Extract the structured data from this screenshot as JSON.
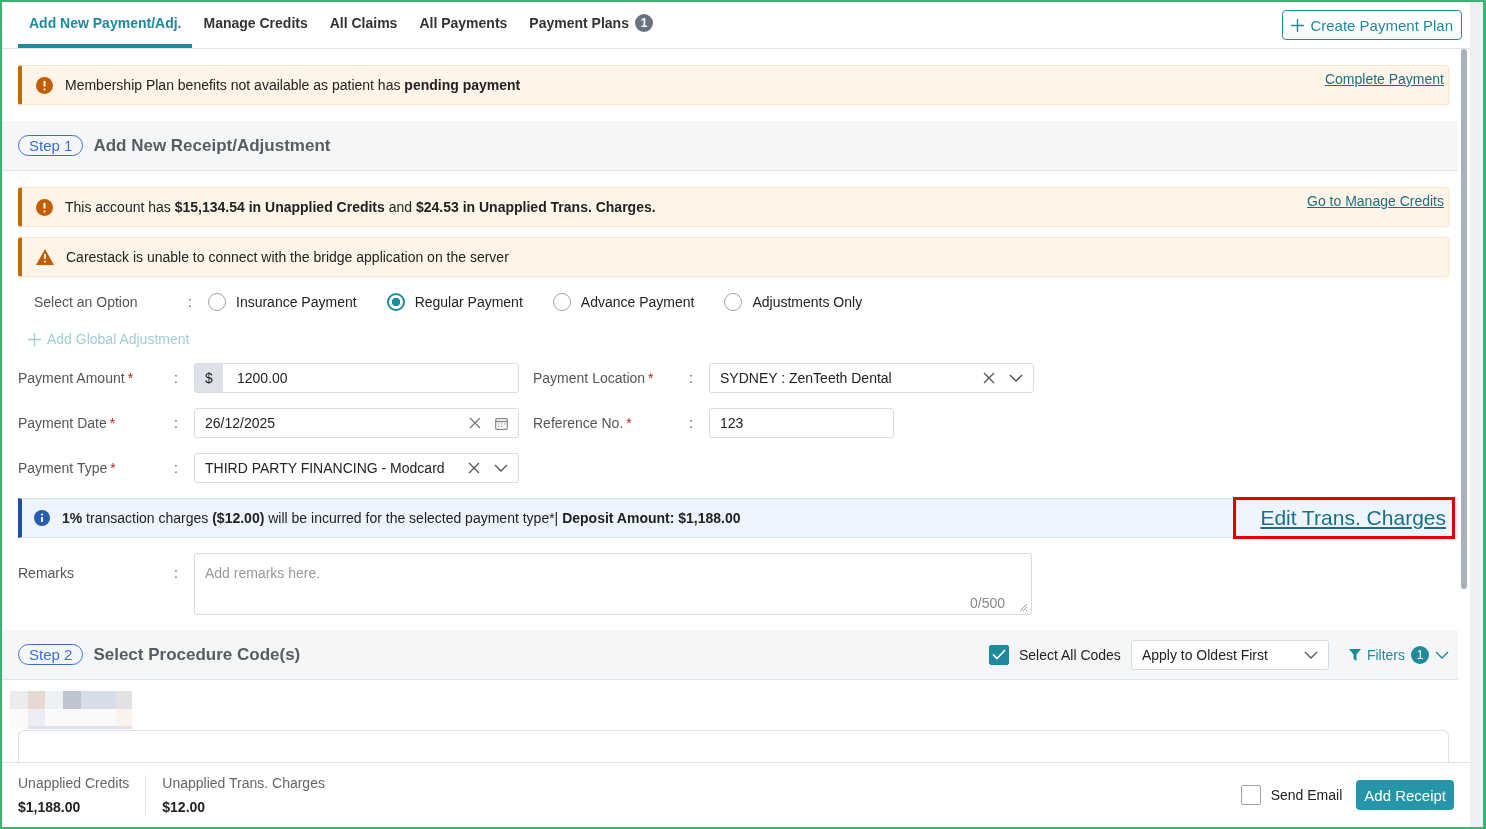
{
  "tabs": [
    {
      "label": "Add New Payment/Adj.",
      "selected": true
    },
    {
      "label": "Manage Credits",
      "selected": false
    },
    {
      "label": "All Claims",
      "selected": false
    },
    {
      "label": "All Payments",
      "selected": false
    },
    {
      "label": "Payment Plans",
      "selected": false,
      "badge": "1"
    }
  ],
  "create_plan_button": "Create Payment Plan",
  "top_alert": {
    "kind": "exclamation",
    "text": "Membership Plan benefits not available as patient has **pending payment**",
    "link": "Complete Payment"
  },
  "step1": {
    "step": "Step 1",
    "title": "Add New Receipt/Adjustment"
  },
  "alerts": [
    {
      "kind": "exclamation",
      "text": "This account has **$15,134.54 in Unapplied Credits** and **$24.53 in Unapplied Trans. Charges.**",
      "link": "Go to Manage Credits"
    },
    {
      "kind": "warning",
      "text": "Carestack is unable to connect with the bridge application on the server"
    }
  ],
  "options": {
    "label": "Select an Option",
    "colon": ":",
    "items": [
      {
        "label": "Insurance Payment",
        "selected": false
      },
      {
        "label": "Regular Payment",
        "selected": true
      },
      {
        "label": "Advance Payment",
        "selected": false
      },
      {
        "label": "Adjustments Only",
        "selected": false
      }
    ]
  },
  "add_global_adjustment": "Add Global Adjustment",
  "fields": [
    {
      "label": "Payment Amount",
      "required_mark": "*",
      "colon": ":",
      "kind": "currency",
      "prefix": "$",
      "value": "1200.00"
    },
    {
      "label": "Payment Location",
      "required_mark": "*",
      "colon": ":",
      "kind": "select",
      "value": "SYDNEY : ZenTeeth Dental"
    },
    {
      "label": "Payment Date",
      "required_mark": "*",
      "colon": ":",
      "kind": "date",
      "value": "26/12/2025"
    },
    {
      "label": "Reference No.",
      "required_mark": "*",
      "colon": ":",
      "kind": "text",
      "value": "123"
    },
    {
      "label": "Payment Type",
      "required_mark": "*",
      "colon": ":",
      "kind": "select",
      "value": "THIRD PARTY FINANCING - Modcard"
    }
  ],
  "info_bar": {
    "text": "**1%** transaction charges **($12.00)** will be incurred for the selected payment type*| **Deposit Amount:  $1,188.00**",
    "link": "Edit Trans. Charges",
    "highlighted": true
  },
  "remarks": {
    "label": "Remarks",
    "colon": ":",
    "placeholder": "Add remarks here.",
    "counter": "0/500"
  },
  "step2": {
    "step": "Step 2",
    "title": "Select Procedure Code(s)",
    "select_all": {
      "label": "Select All Codes",
      "checked": true
    },
    "apply_select": "Apply to Oldest First",
    "filters": {
      "label": "Filters",
      "badge": "1"
    }
  },
  "footer": {
    "summaries": [
      {
        "label": "Unapplied Credits",
        "value": "$1,188.00"
      },
      {
        "label": "Unapplied Trans. Charges",
        "value": "$12.00"
      }
    ],
    "send_email": {
      "label": "Send Email",
      "checked": false
    },
    "submit": "Add Receipt"
  }
}
